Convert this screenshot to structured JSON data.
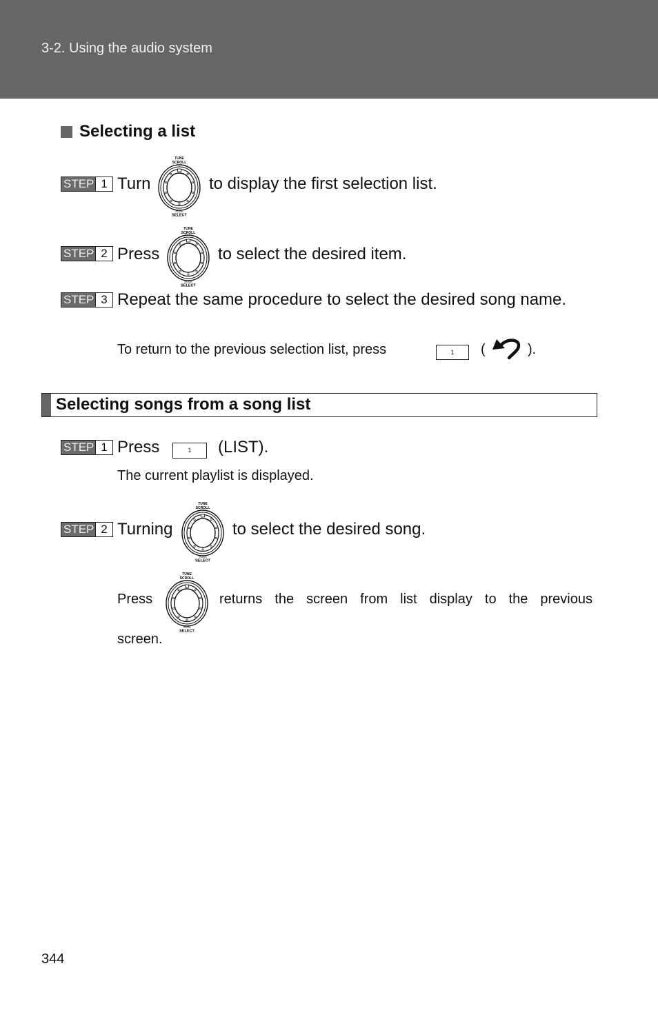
{
  "header": {
    "title": "3-2. Using the audio system"
  },
  "section1": {
    "heading": "Selecting a list",
    "steps": [
      {
        "label": "STEP",
        "num": "1",
        "before": "Turn",
        "after": "to display the first selection list."
      },
      {
        "label": "STEP",
        "num": "2",
        "before": "Press",
        "after": "to select the desired item."
      },
      {
        "label": "STEP",
        "num": "3",
        "text": "Repeat the same procedure to select the desired song name."
      }
    ],
    "note": {
      "before": "To return to the previous selection list, press",
      "button": "1",
      "paren_open": "(",
      "paren_close": ")."
    }
  },
  "section2": {
    "heading": "Selecting songs from a song list",
    "steps": [
      {
        "label": "STEP",
        "num": "1",
        "before": "Press",
        "button": "1",
        "after": "(LIST).",
        "sub": "The current playlist is displayed."
      },
      {
        "label": "STEP",
        "num": "2",
        "before": "Turning",
        "after": "to select the desired song."
      }
    ],
    "note": {
      "before": "Press",
      "after": "returns the screen from list display to the previous",
      "after2": "screen."
    }
  },
  "knob": {
    "top_label1": "TUNE",
    "top_label2": "SCROLL",
    "bottom_label1": "PUSH",
    "bottom_label2": "SELECT"
  },
  "page_number": "344"
}
